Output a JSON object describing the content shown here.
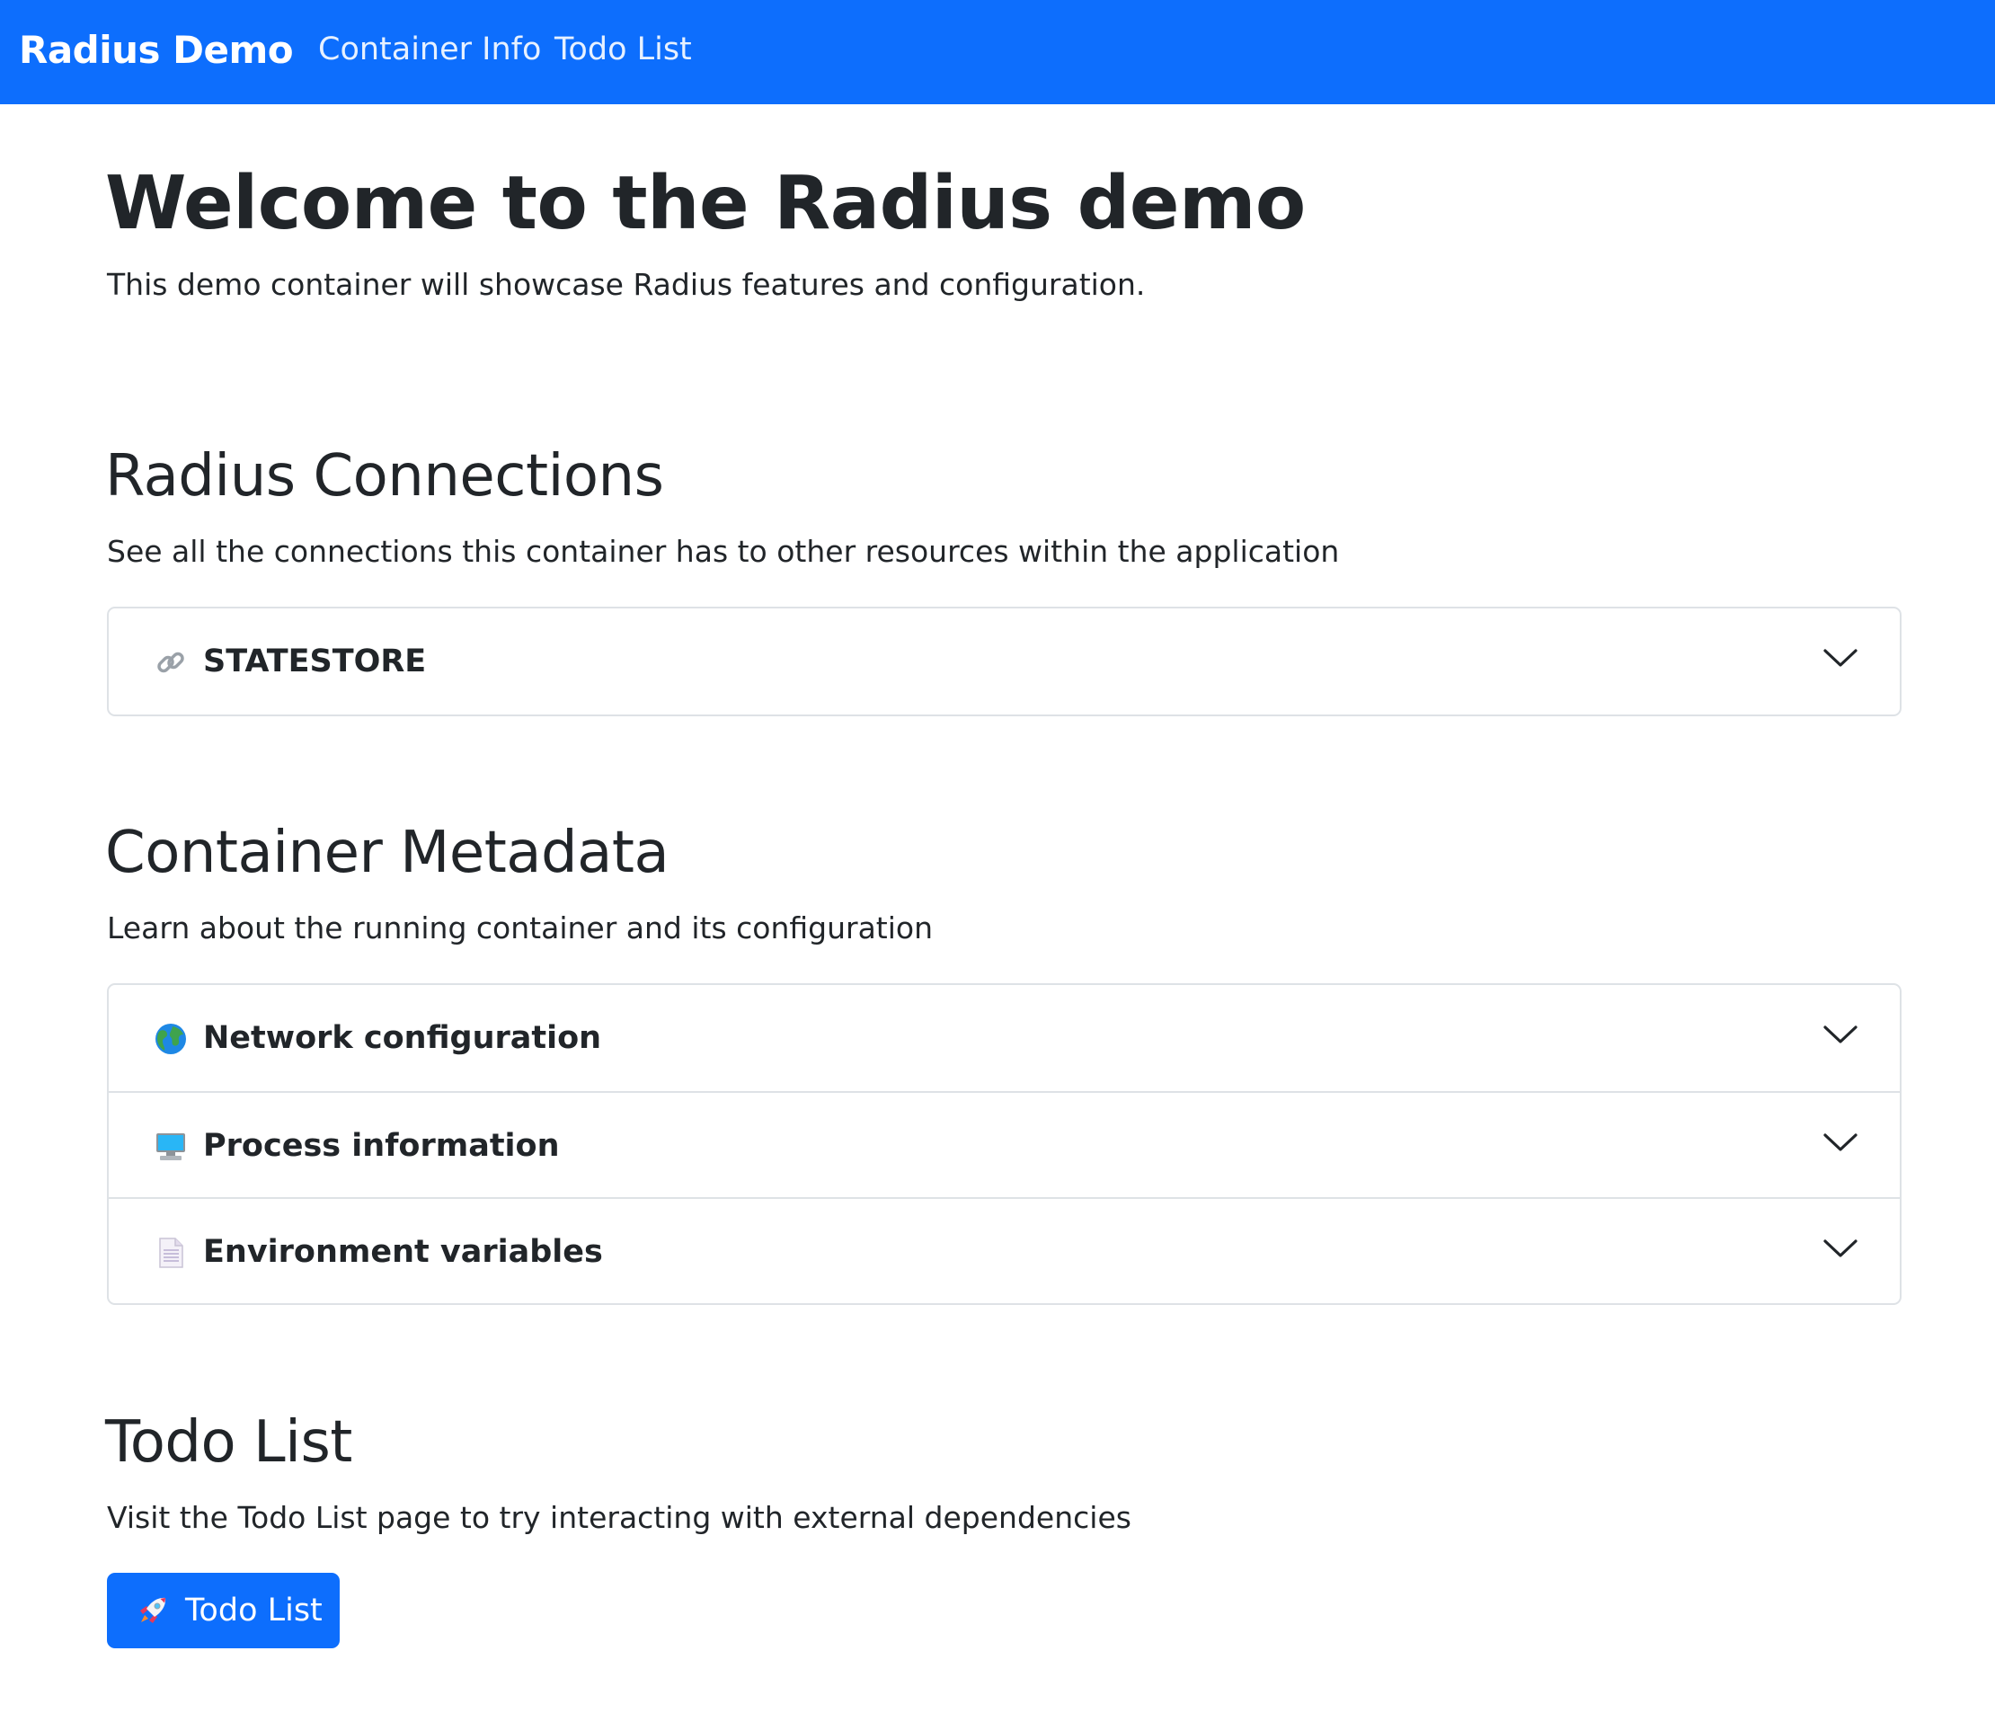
{
  "navbar": {
    "brand": "Radius Demo",
    "links": [
      "Container Info",
      "Todo List"
    ],
    "background_color": "#0d6efd"
  },
  "welcome": {
    "title": "Welcome to the Radius demo",
    "subtitle": "This demo container will showcase Radius features and configuration."
  },
  "connections": {
    "title": "Radius Connections",
    "description": "See all the connections this container has to other resources within the application",
    "items": [
      {
        "icon": "link-icon",
        "label": "STATESTORE"
      }
    ]
  },
  "metadata": {
    "title": "Container Metadata",
    "description": "Learn about the running container and its configuration",
    "items": [
      {
        "icon": "globe-icon",
        "label": "Network configuration"
      },
      {
        "icon": "computer-icon",
        "label": "Process information"
      },
      {
        "icon": "document-icon",
        "label": "Environment variables"
      }
    ]
  },
  "todo": {
    "title": "Todo List",
    "description": "Visit the Todo List page to try interacting with external dependencies",
    "button_icon": "rocket-icon",
    "button_label": "Todo List"
  }
}
